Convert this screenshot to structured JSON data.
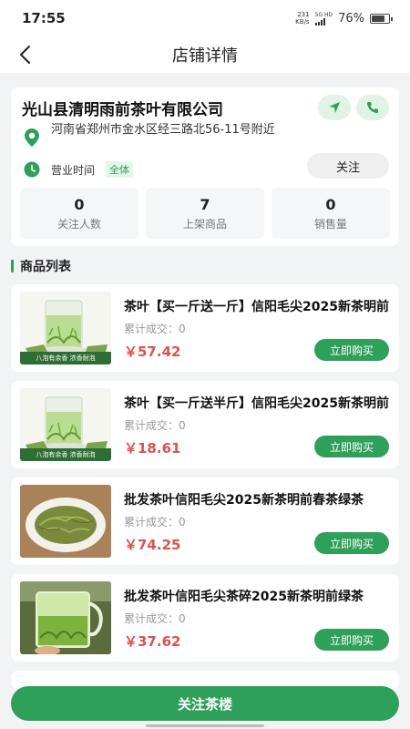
{
  "status_bar": {
    "time": "17:55",
    "net_speed_value": "231",
    "net_speed_unit": "KB/s",
    "network": "5G HD",
    "battery_pct": "76%",
    "battery_level": 0.76
  },
  "header": {
    "title": "店铺详情"
  },
  "shop": {
    "name": "光山县清明雨前茶叶有限公司",
    "address": "河南省郑州市金水区经三路北56-11号附近",
    "hours_label": "营业时间",
    "hours_value": "全体",
    "follow_label": "关注",
    "stats": [
      {
        "value": "0",
        "label": "关注人数"
      },
      {
        "value": "7",
        "label": "上架商品"
      },
      {
        "value": "0",
        "label": "销售量"
      }
    ]
  },
  "products_section": {
    "title": "商品列表",
    "items": [
      {
        "name": "茶叶【买一斤送一斤】信阳毛尖2025新茶明前",
        "sold": "累计成交：0",
        "price": "￥57.42",
        "buy_label": "立即购买",
        "banner": "八泡有余香 浓香耐泡"
      },
      {
        "name": "茶叶【买一斤送半斤】信阳毛尖2025新茶明前",
        "sold": "累计成交：0",
        "price": "￥18.61",
        "buy_label": "立即购买",
        "banner": "八泡有余香 浓香耐泡"
      },
      {
        "name": "批发茶叶信阳毛尖2025新茶明前春茶绿茶",
        "sold": "累计成交：0",
        "price": "￥74.25",
        "buy_label": "立即购买"
      },
      {
        "name": "批发茶叶信阳毛尖茶碎2025新茶明前绿茶",
        "sold": "累计成交：0",
        "price": "￥37.62",
        "buy_label": "立即购买"
      }
    ]
  },
  "footer": {
    "follow_shop_label": "关注茶楼"
  },
  "colors": {
    "accent": "#2ea05a",
    "price": "#d9534f",
    "background": "#f2f3f5"
  }
}
